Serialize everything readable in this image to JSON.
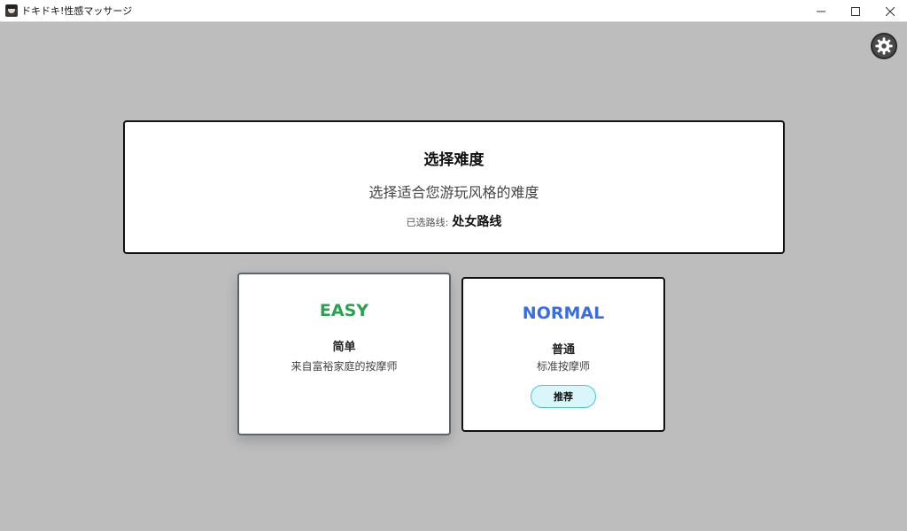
{
  "window": {
    "title": "ドキドキ!性感マッサージ",
    "minimize": "—",
    "maximize": "☐",
    "close": "✕"
  },
  "header": {
    "title": "选择难度",
    "subtitle": "选择适合您游玩风格的难度",
    "route_label": "已选路线:",
    "route_value": "处女路线"
  },
  "cards": {
    "easy": {
      "level": "EASY",
      "name": "简单",
      "desc": "来自富裕家庭的按摩师",
      "color": "#2e9e4f"
    },
    "normal": {
      "level": "NORMAL",
      "name": "普通",
      "desc": "标准按摩师",
      "badge": "推荐",
      "color": "#3a6fd8"
    }
  },
  "icons": {
    "settings": "gear-icon",
    "app": "app-icon"
  }
}
